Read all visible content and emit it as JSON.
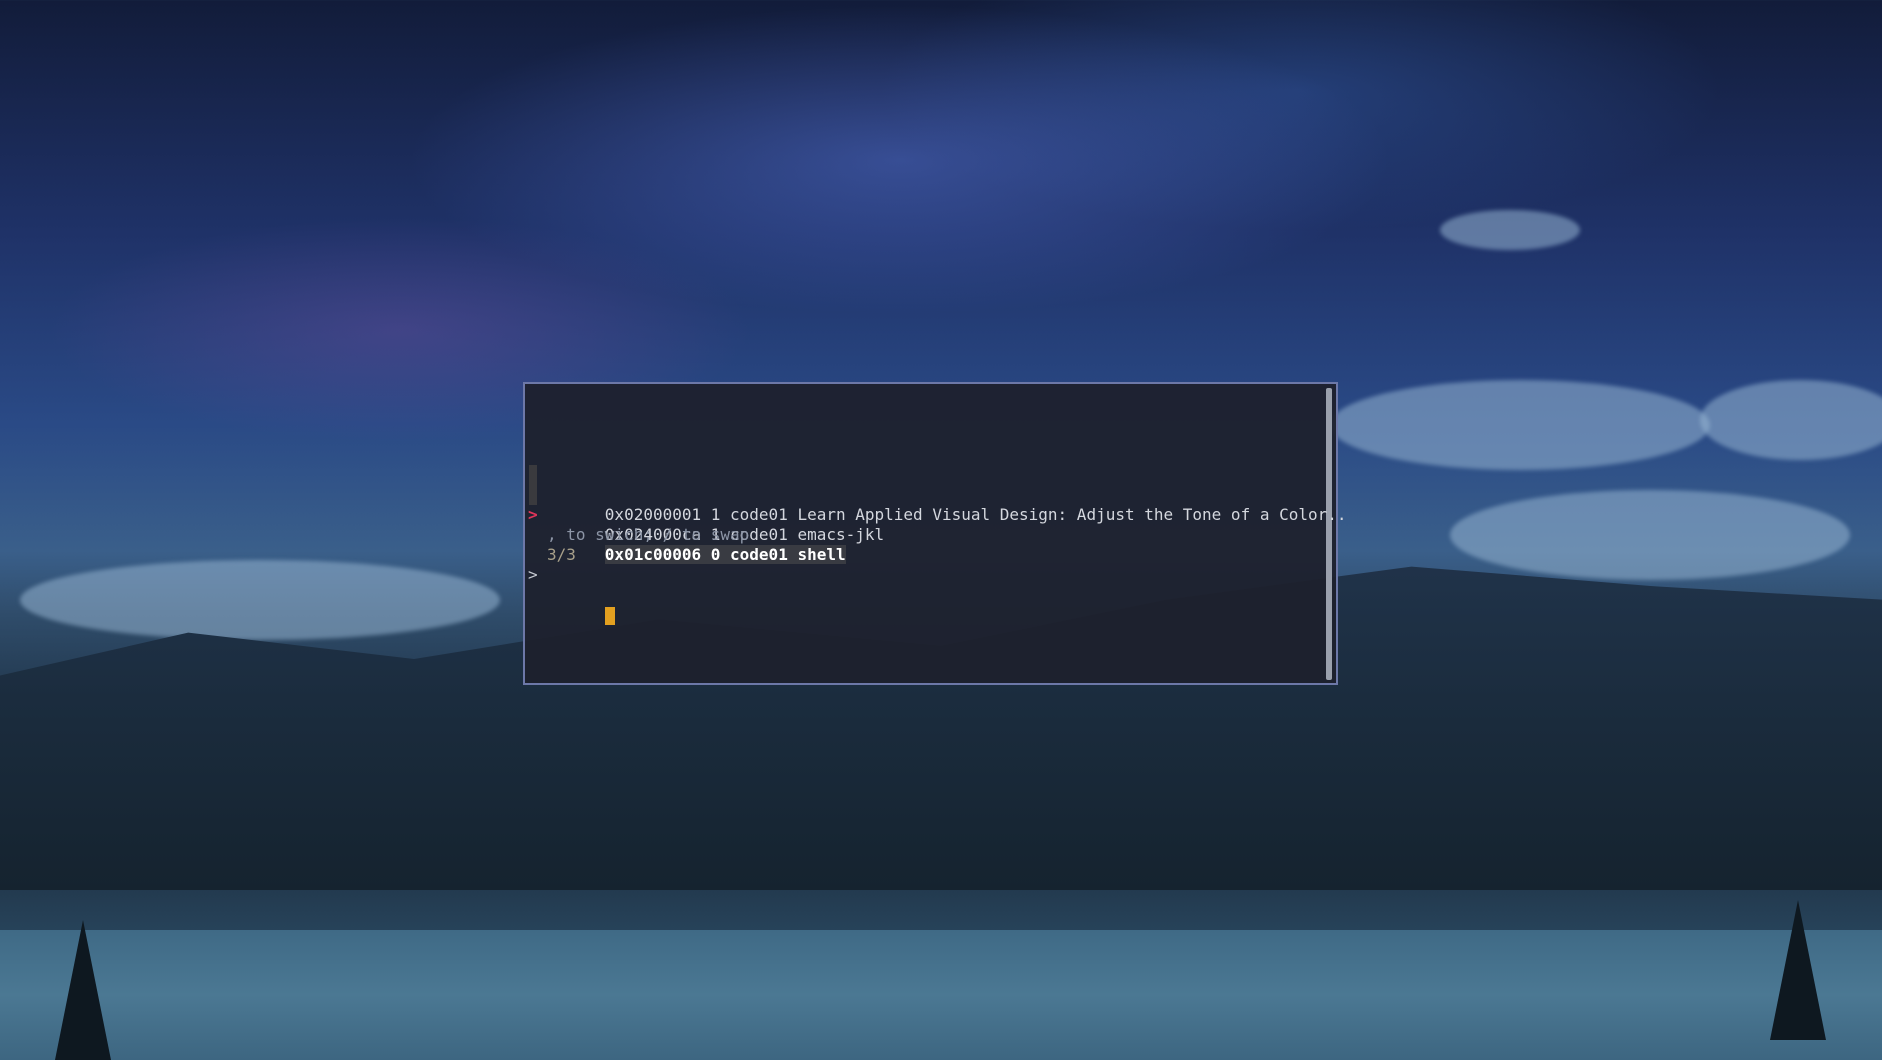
{
  "terminal": {
    "window_list": [
      {
        "text": "0x02000001 1 code01 Learn Applied Visual Design: Adjust the Tone of a Color.."
      },
      {
        "text": "0x024000ca 1 code01 emacs-jkl"
      },
      {
        "text": "0x01c00006 0 code01 shell"
      }
    ],
    "selected_marker": ">",
    "hint": ", to swich; / to swap",
    "match_count": "3/3",
    "prompt_symbol": ">",
    "input_value": ""
  },
  "colors": {
    "marker": "#e0355a",
    "cursor": "#e3a020",
    "border": "#6d78a8"
  }
}
